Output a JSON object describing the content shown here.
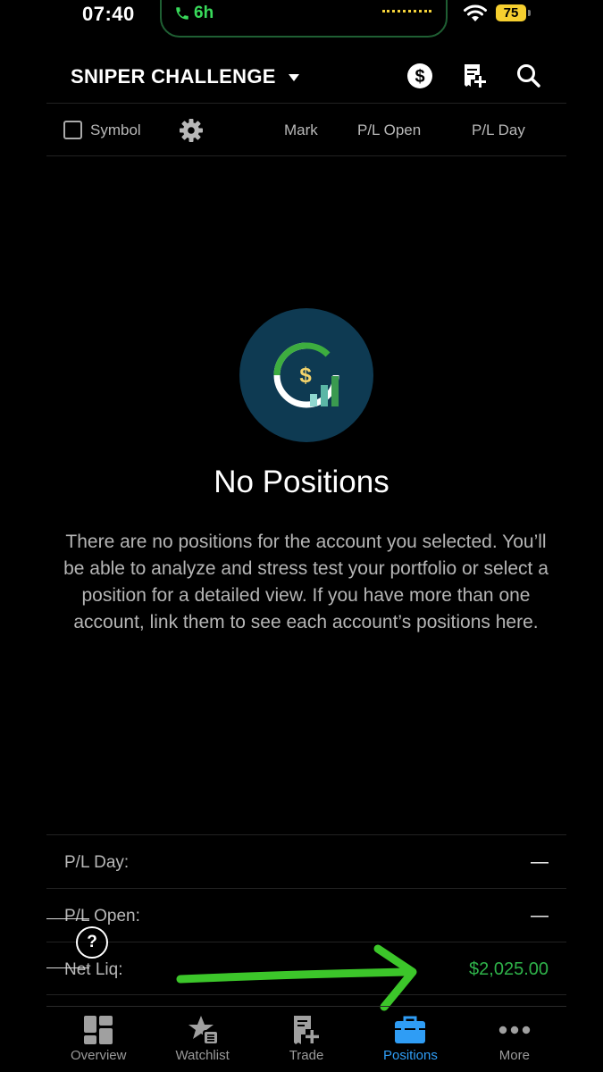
{
  "status_bar": {
    "time": "07:40",
    "call_duration": "6h",
    "battery": "75"
  },
  "header": {
    "account_name": "SNIPER CHALLENGE"
  },
  "columns": {
    "symbol": "Symbol",
    "mark": "Mark",
    "pl_open": "P/L Open",
    "pl_day": "P/L Day"
  },
  "empty_state": {
    "title": "No Positions",
    "body": "There are no positions for the account you selected. You’ll be able to analyze and stress test your portfolio or select a position for a detailed view. If you have more than one account, link them to see each account’s positions here."
  },
  "summary": [
    {
      "label": "P/L Day:",
      "value": "—"
    },
    {
      "label": "P/L Open:",
      "value": "—"
    },
    {
      "label": "Net Liq:",
      "value": "$2,025.00"
    }
  ],
  "help": {
    "glyph": "?"
  },
  "tabs": [
    {
      "label": "Overview",
      "icon": "grid-icon"
    },
    {
      "label": "Watchlist",
      "icon": "star-list-icon"
    },
    {
      "label": "Trade",
      "icon": "trade-ticket-icon"
    },
    {
      "label": "Positions",
      "icon": "briefcase-icon",
      "active": true
    },
    {
      "label": "More",
      "icon": "more-dots-icon"
    }
  ],
  "colors": {
    "accent_blue": "#2f9df5",
    "positive_green": "#2fb34a",
    "annotation_arrow": "#3cc62a"
  }
}
